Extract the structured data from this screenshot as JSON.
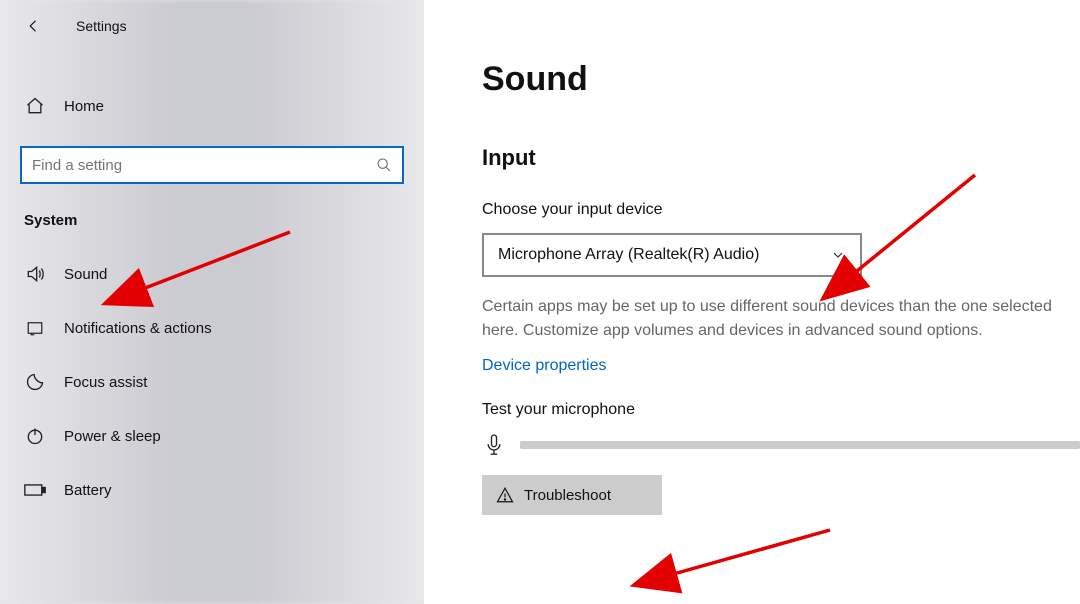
{
  "titlebar": {
    "title": "Settings"
  },
  "sidebar": {
    "home_label": "Home",
    "search_placeholder": "Find a setting",
    "section_header": "System",
    "items": [
      {
        "label": "Sound"
      },
      {
        "label": "Notifications & actions"
      },
      {
        "label": "Focus assist"
      },
      {
        "label": "Power & sleep"
      },
      {
        "label": "Battery"
      }
    ]
  },
  "main": {
    "page_title": "Sound",
    "input_header": "Input",
    "choose_label": "Choose your input device",
    "selected_device": "Microphone Array (Realtek(R) Audio)",
    "description": "Certain apps may be set up to use different sound devices than the one selected here. Customize app volumes and devices in advanced sound options.",
    "device_properties_link": "Device properties",
    "test_mic_label": "Test your microphone",
    "troubleshoot_label": "Troubleshoot"
  }
}
